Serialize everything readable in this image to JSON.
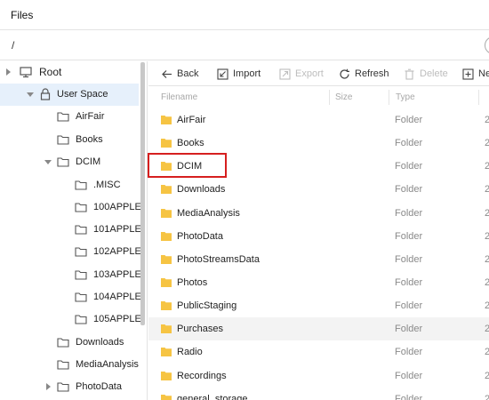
{
  "window": {
    "title": "Files"
  },
  "pathbar": {
    "path": "/"
  },
  "tree": {
    "items": [
      {
        "label": "Root",
        "arrow": "right",
        "icon": "computer"
      },
      {
        "label": "User Space",
        "arrow": "down",
        "icon": "lock"
      },
      {
        "label": "AirFair",
        "arrow": "",
        "icon": "folder-outline"
      },
      {
        "label": "Books",
        "arrow": "",
        "icon": "folder-outline"
      },
      {
        "label": "DCIM",
        "arrow": "down",
        "icon": "folder-outline"
      },
      {
        "label": ".MISC",
        "arrow": "",
        "icon": "folder-outline"
      },
      {
        "label": "100APPLE",
        "arrow": "",
        "icon": "folder-outline"
      },
      {
        "label": "101APPLE",
        "arrow": "",
        "icon": "folder-outline"
      },
      {
        "label": "102APPLE",
        "arrow": "",
        "icon": "folder-outline"
      },
      {
        "label": "103APPLE",
        "arrow": "",
        "icon": "folder-outline"
      },
      {
        "label": "104APPLE",
        "arrow": "",
        "icon": "folder-outline"
      },
      {
        "label": "105APPLE",
        "arrow": "",
        "icon": "folder-outline"
      },
      {
        "label": "Downloads",
        "arrow": "",
        "icon": "folder-outline"
      },
      {
        "label": "MediaAnalysis",
        "arrow": "",
        "icon": "folder-outline"
      },
      {
        "label": "PhotoData",
        "arrow": "right",
        "icon": "folder-outline"
      }
    ]
  },
  "toolbar": {
    "back_label": "Back",
    "import_label": "Import",
    "export_label": "Export",
    "refresh_label": "Refresh",
    "delete_label": "Delete",
    "new_label": "Ne"
  },
  "columns": {
    "filename": "Filename",
    "size": "Size",
    "type": "Type"
  },
  "files": [
    {
      "name": "AirFair",
      "type": "Folder",
      "date": "2"
    },
    {
      "name": "Books",
      "type": "Folder",
      "date": "2"
    },
    {
      "name": "DCIM",
      "type": "Folder",
      "date": "2"
    },
    {
      "name": "Downloads",
      "type": "Folder",
      "date": "2"
    },
    {
      "name": "MediaAnalysis",
      "type": "Folder",
      "date": "2"
    },
    {
      "name": "PhotoData",
      "type": "Folder",
      "date": "2"
    },
    {
      "name": "PhotoStreamsData",
      "type": "Folder",
      "date": "2"
    },
    {
      "name": "Photos",
      "type": "Folder",
      "date": "2"
    },
    {
      "name": "PublicStaging",
      "type": "Folder",
      "date": "2"
    },
    {
      "name": "Purchases",
      "type": "Folder",
      "date": "2"
    },
    {
      "name": "Radio",
      "type": "Folder",
      "date": "2"
    },
    {
      "name": "Recordings",
      "type": "Folder",
      "date": "2"
    },
    {
      "name": "general_storage",
      "type": "Folder",
      "date": "2"
    }
  ],
  "colors": {
    "accent": "#d61f1f",
    "selected": "#e6f0fb",
    "folder": "#f6c443"
  }
}
